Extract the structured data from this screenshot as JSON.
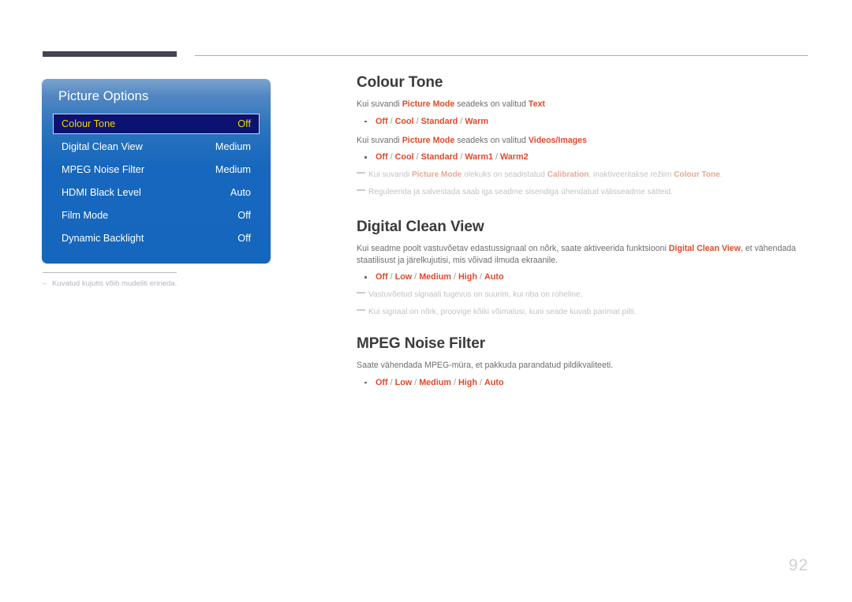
{
  "colors": {
    "accent": "#e0492a",
    "body_text": "#6e6e6e",
    "heading": "#3b3b3b",
    "note_text": "#c3c3c8",
    "osd_selected_bg": "#0b1270",
    "osd_selected_text": "#f5d300",
    "osd_blue": "#1567bd",
    "header_bar": "#434353",
    "page_number": "#cfcfd6"
  },
  "osd": {
    "title": "Picture Options",
    "rows": [
      {
        "label": "Colour Tone",
        "value": "Off",
        "selected": true
      },
      {
        "label": "Digital Clean View",
        "value": "Medium",
        "selected": false
      },
      {
        "label": "MPEG Noise Filter",
        "value": "Medium",
        "selected": false
      },
      {
        "label": "HDMI Black Level",
        "value": "Auto",
        "selected": false
      },
      {
        "label": "Film Mode",
        "value": "Off",
        "selected": false
      },
      {
        "label": "Dynamic Backlight",
        "value": "Off",
        "selected": false
      }
    ],
    "caption": "Kuvatud kujutis võib mudeliti erineda.",
    "caption_dash": "–"
  },
  "sections": {
    "colour_tone": {
      "heading": "Colour Tone",
      "para1_pre": "Kui suvandi ",
      "para1_accent1": "Picture Mode",
      "para1_mid": " seadeks on valitud ",
      "para1_accent2": "Text",
      "bullet1": {
        "o1": "Off",
        "s1": " / ",
        "o2": "Cool",
        "s2": " / ",
        "o3": "Standard",
        "s3": " / ",
        "o4": "Warm"
      },
      "para2_pre": "Kui suvandi ",
      "para2_accent1": "Picture Mode",
      "para2_mid": " seadeks on valitud ",
      "para2_accent2": "Videos/Images",
      "bullet2": {
        "o1": "Off",
        "s1": " / ",
        "o2": "Cool",
        "s2": " / ",
        "o3": "Standard",
        "s3": " / ",
        "o4": "Warm1",
        "s4": " / ",
        "o5": "Warm2"
      },
      "note1_pre": "Kui suvandi ",
      "note1_accent1": "Picture Mode",
      "note1_mid": " olekuks on seadistatud ",
      "note1_accent2": "Calibration",
      "note1_mid2": ", inaktiveeritakse režiim ",
      "note1_accent3": "Colour Tone",
      "note1_end": ".",
      "note2": "Reguleerida ja salvestada saab iga seadme sisendiga ühendatud välisseadme sätteid."
    },
    "digital_clean_view": {
      "heading": "Digital Clean View",
      "para_pre": "Kui seadme poolt vastuvõetav edastussignaal on nõrk, saate aktiveerida funktsiooni ",
      "para_accent": "Digital Clean View",
      "para_post": ", et vähendada staatilisust ja järelkujutisi, mis võivad ilmuda ekraanile.",
      "bullet": {
        "o1": "Off",
        "s1": " / ",
        "o2": "Low",
        "s2": " / ",
        "o3": "Medium",
        "s3": " / ",
        "o4": "High",
        "s4": " / ",
        "o5": "Auto"
      },
      "note1": "Vastuvõetud signaali tugevus on suurim, kui riba on roheline.",
      "note2": "Kui signaal on nõrk, proovige kõiki võimalusi, kuni seade kuvab parimat pilti."
    },
    "mpeg_noise_filter": {
      "heading": "MPEG Noise Filter",
      "para": "Saate vähendada MPEG-müra, et pakkuda parandatud pildikvaliteeti.",
      "bullet": {
        "o1": "Off",
        "s1": " / ",
        "o2": "Low",
        "s2": " / ",
        "o3": "Medium",
        "s3": " / ",
        "o4": "High",
        "s4": " / ",
        "o5": "Auto"
      }
    }
  },
  "page_number": "92"
}
